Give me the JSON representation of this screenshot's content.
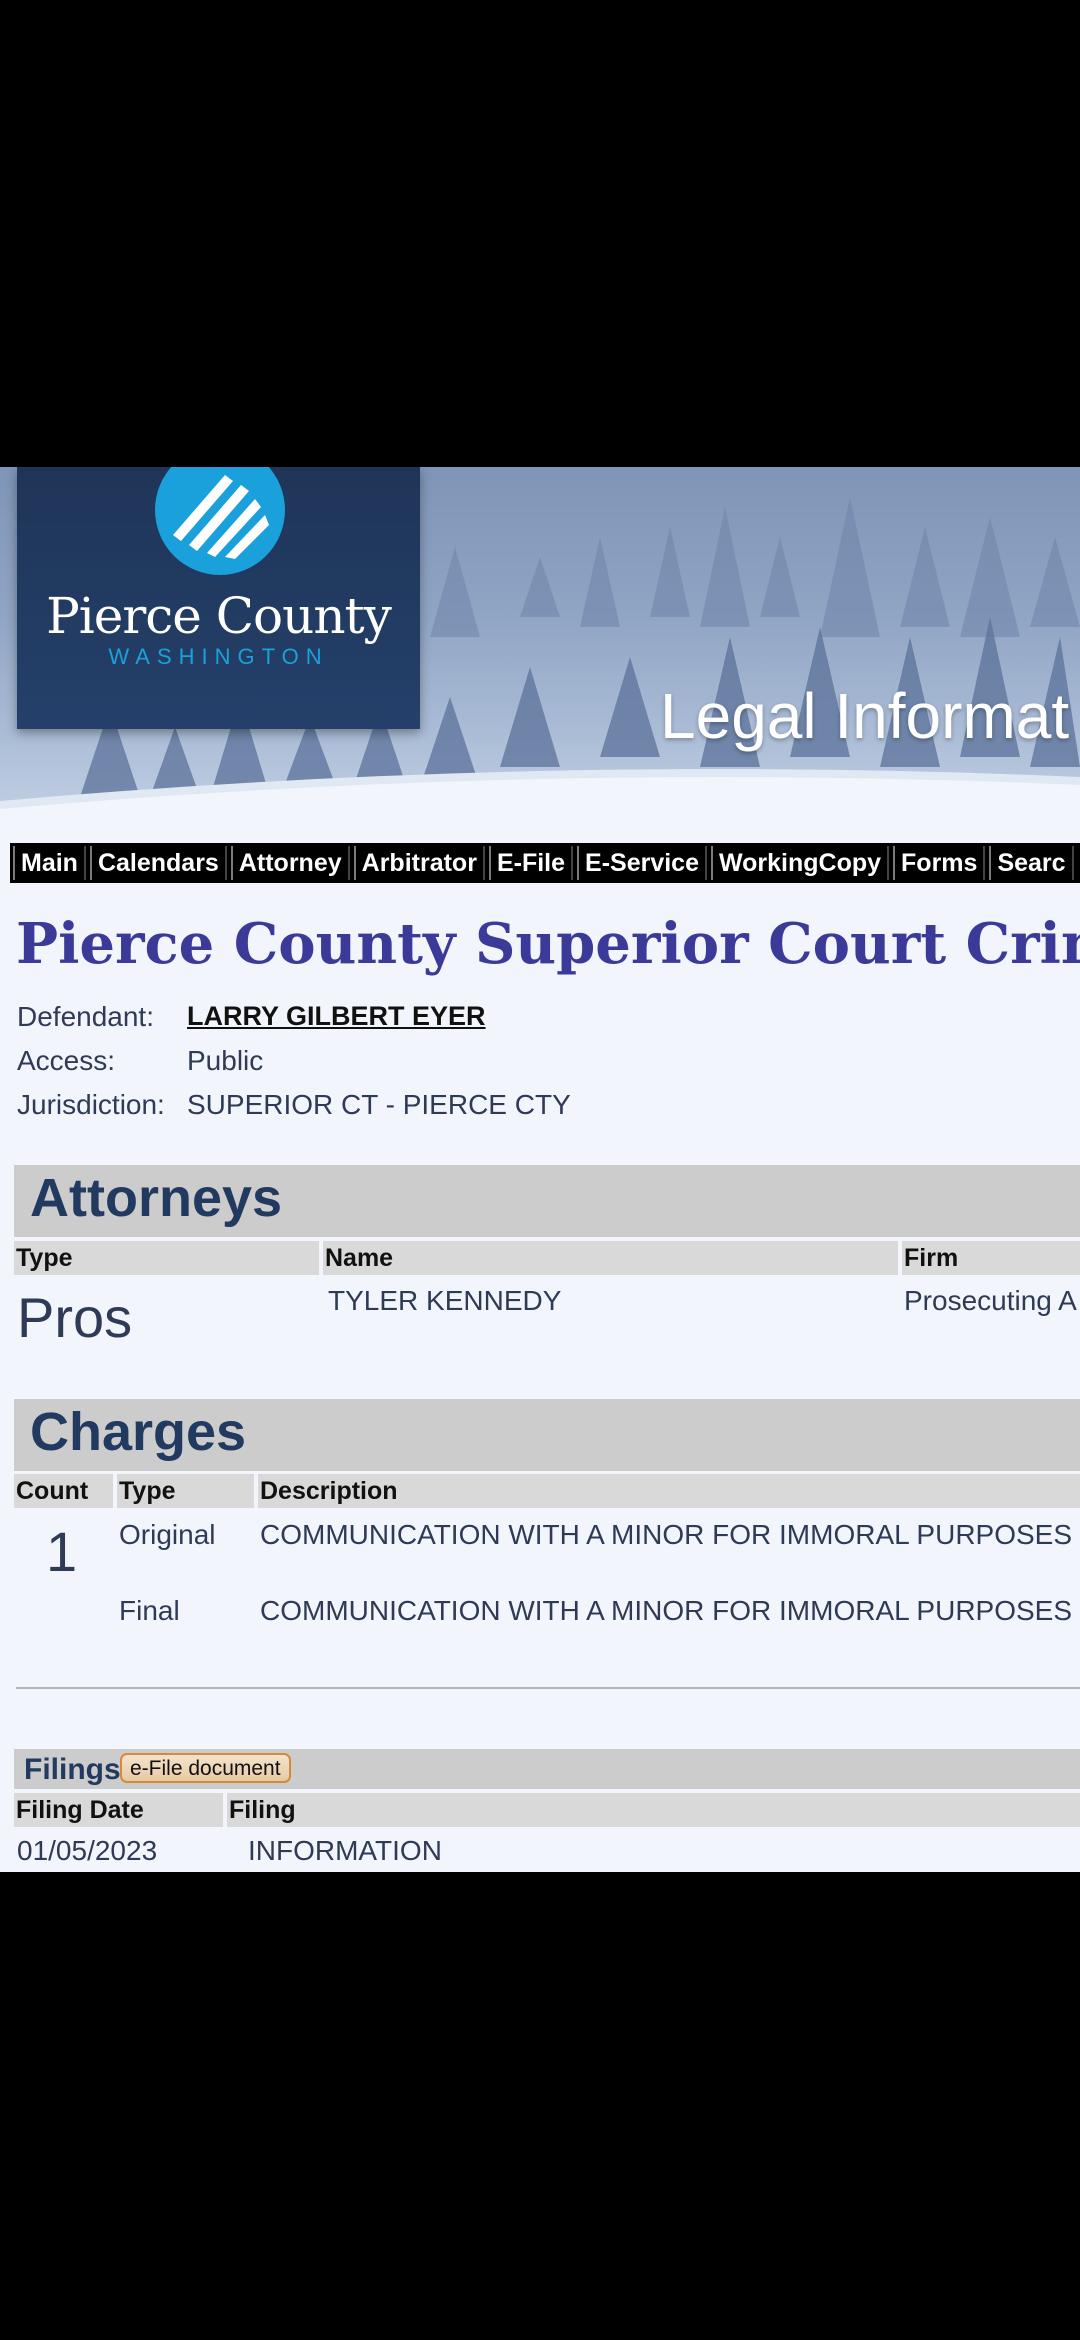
{
  "banner": {
    "logo_name": "Pierce County",
    "logo_state": "WASHINGTON",
    "title": "Legal Informat"
  },
  "nav": [
    "Main",
    "Calendars",
    "Attorney",
    "Arbitrator",
    "E-File",
    "E-Service",
    "WorkingCopy",
    "Forms",
    "Searc"
  ],
  "case": {
    "title": "Pierce County Superior Court Crim",
    "defendant_label": "Defendant:",
    "defendant": "LARRY GILBERT EYER",
    "access_label": "Access:",
    "access": "Public",
    "jurisdiction_label": "Jurisdiction:",
    "jurisdiction": "SUPERIOR CT - PIERCE CTY"
  },
  "attorneys": {
    "heading": "Attorneys",
    "columns": [
      "Type",
      "Name",
      "Firm"
    ],
    "rows": [
      {
        "type": "Pros",
        "name": "TYLER KENNEDY",
        "firm": "Prosecuting A"
      }
    ]
  },
  "charges": {
    "heading": "Charges",
    "columns": [
      "Count",
      "Type",
      "Description"
    ],
    "count": "1",
    "rows": [
      {
        "type": "Original",
        "description": "COMMUNICATION WITH A MINOR FOR IMMORAL PURPOSES"
      },
      {
        "type": "Final",
        "description": "COMMUNICATION WITH A MINOR FOR IMMORAL PURPOSES"
      }
    ]
  },
  "filings": {
    "heading": "Filings",
    "efile_button": "e-File document",
    "columns": [
      "Filing Date",
      "Filing"
    ],
    "rows": [
      {
        "date": "01/05/2023",
        "filing": "INFORMATION"
      }
    ]
  },
  "colors": {
    "court_title": "#3b3a99",
    "section_heading": "#233a60",
    "logo_accent": "#1aa0db"
  }
}
